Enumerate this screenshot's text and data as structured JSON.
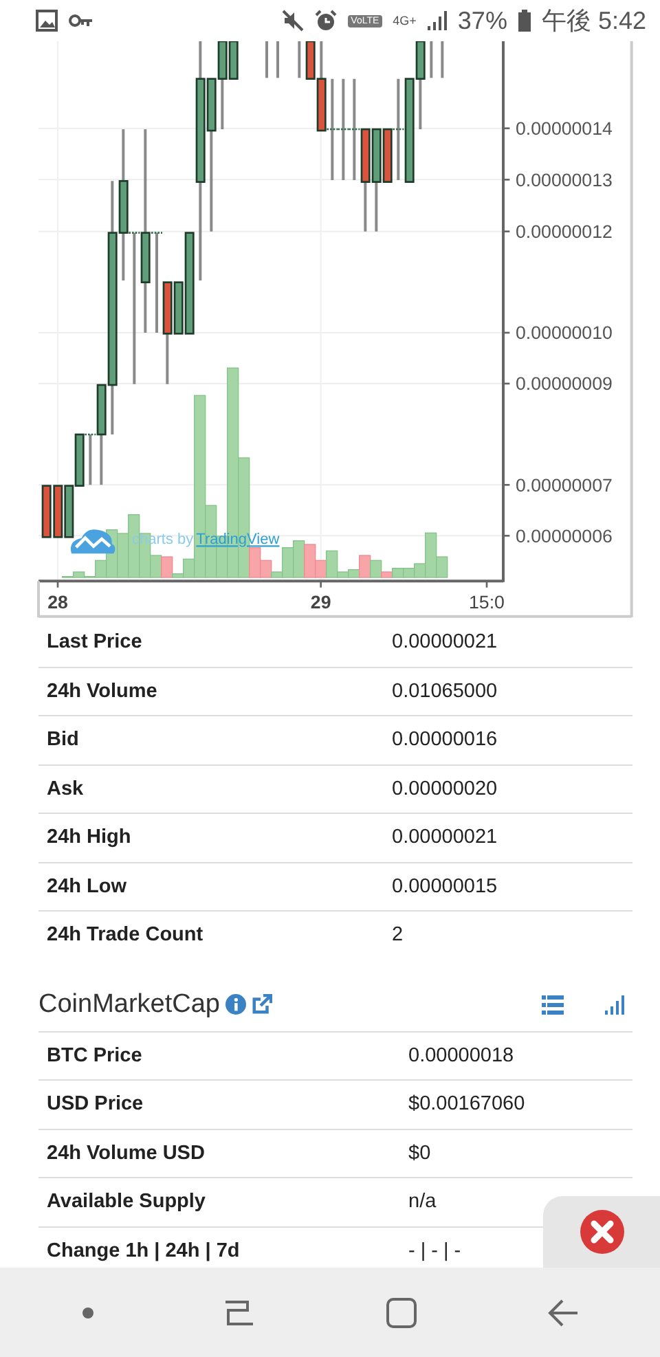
{
  "status_bar": {
    "volte": "VoLTE",
    "network": "4G+",
    "battery": "37%",
    "time": "午後 5:42"
  },
  "chart": {
    "y_ticks": [
      "0.00000014",
      "0.00000013",
      "0.00000012",
      "0.00000010",
      "0.00000009",
      "0.00000007",
      "0.00000006"
    ],
    "x_ticks": [
      "28",
      "29",
      "15:0"
    ],
    "attribution": "charts by",
    "attribution_link": "TradingView"
  },
  "market_stats": [
    {
      "label": "Last Price",
      "value": "0.00000021"
    },
    {
      "label": "24h Volume",
      "value": "0.01065000"
    },
    {
      "label": "Bid",
      "value": "0.00000016"
    },
    {
      "label": "Ask",
      "value": "0.00000020"
    },
    {
      "label": "24h High",
      "value": "0.00000021"
    },
    {
      "label": "24h Low",
      "value": "0.00000015"
    },
    {
      "label": "24h Trade Count",
      "value": "2"
    }
  ],
  "coinmarketcap": {
    "title": "CoinMarketCap",
    "rows": [
      {
        "label": "BTC Price",
        "value": "0.00000018"
      },
      {
        "label": "USD Price",
        "value": "$0.00167060"
      },
      {
        "label": "24h Volume USD",
        "value": "$0"
      },
      {
        "label": "Available Supply",
        "value": "n/a"
      },
      {
        "label": "Change 1h | 24h | 7d",
        "value": "- | - | -"
      }
    ]
  }
}
